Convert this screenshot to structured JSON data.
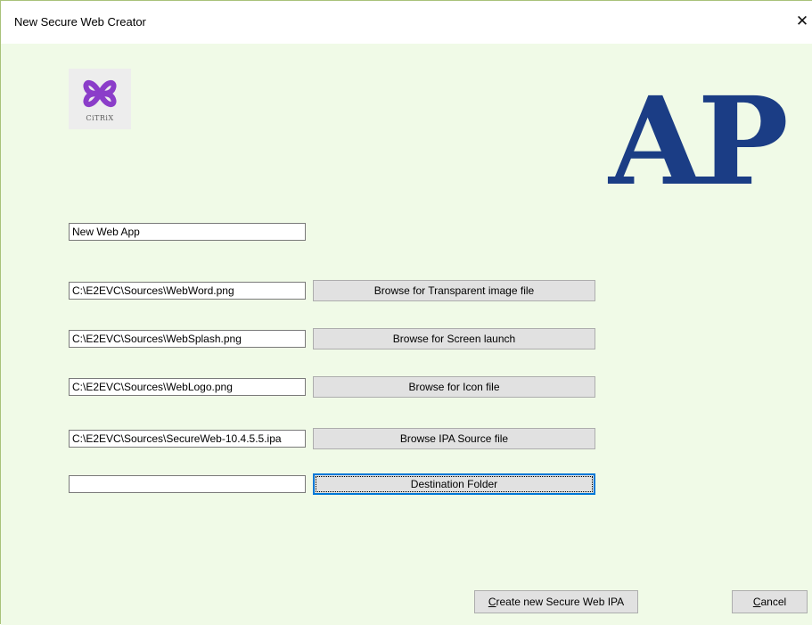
{
  "window": {
    "title": "New Secure Web Creator",
    "close_glyph": "✕"
  },
  "logos": {
    "citrix_icon": "citrix-butterfly-icon",
    "citrix_text": "CiTRiX",
    "brand_text": "AP",
    "brand_color": "#1b3d85",
    "citrix_color": "#8b3dc9"
  },
  "form": {
    "app_name": "New Web App",
    "rows": [
      {
        "path": "C:\\E2EVC\\Sources\\WebWord.png",
        "button": "Browse for Transparent image file"
      },
      {
        "path": "C:\\E2EVC\\Sources\\WebSplash.png",
        "button": "Browse for Screen launch"
      },
      {
        "path": "C:\\E2EVC\\Sources\\WebLogo.png",
        "button": "Browse for Icon file"
      },
      {
        "path": "C:\\E2EVC\\Sources\\SecureWeb-10.4.5.5.ipa",
        "button": "Browse IPA Source file"
      },
      {
        "path": "",
        "button": "Destination Folder"
      }
    ]
  },
  "footer": {
    "create_first": "C",
    "create_rest": "reate new Secure Web IPA",
    "cancel_first": "C",
    "cancel_rest": "ancel"
  },
  "colors": {
    "client_background": "#f0fae7",
    "button_face": "#e1e1e1",
    "focus_border": "#0078d7"
  }
}
